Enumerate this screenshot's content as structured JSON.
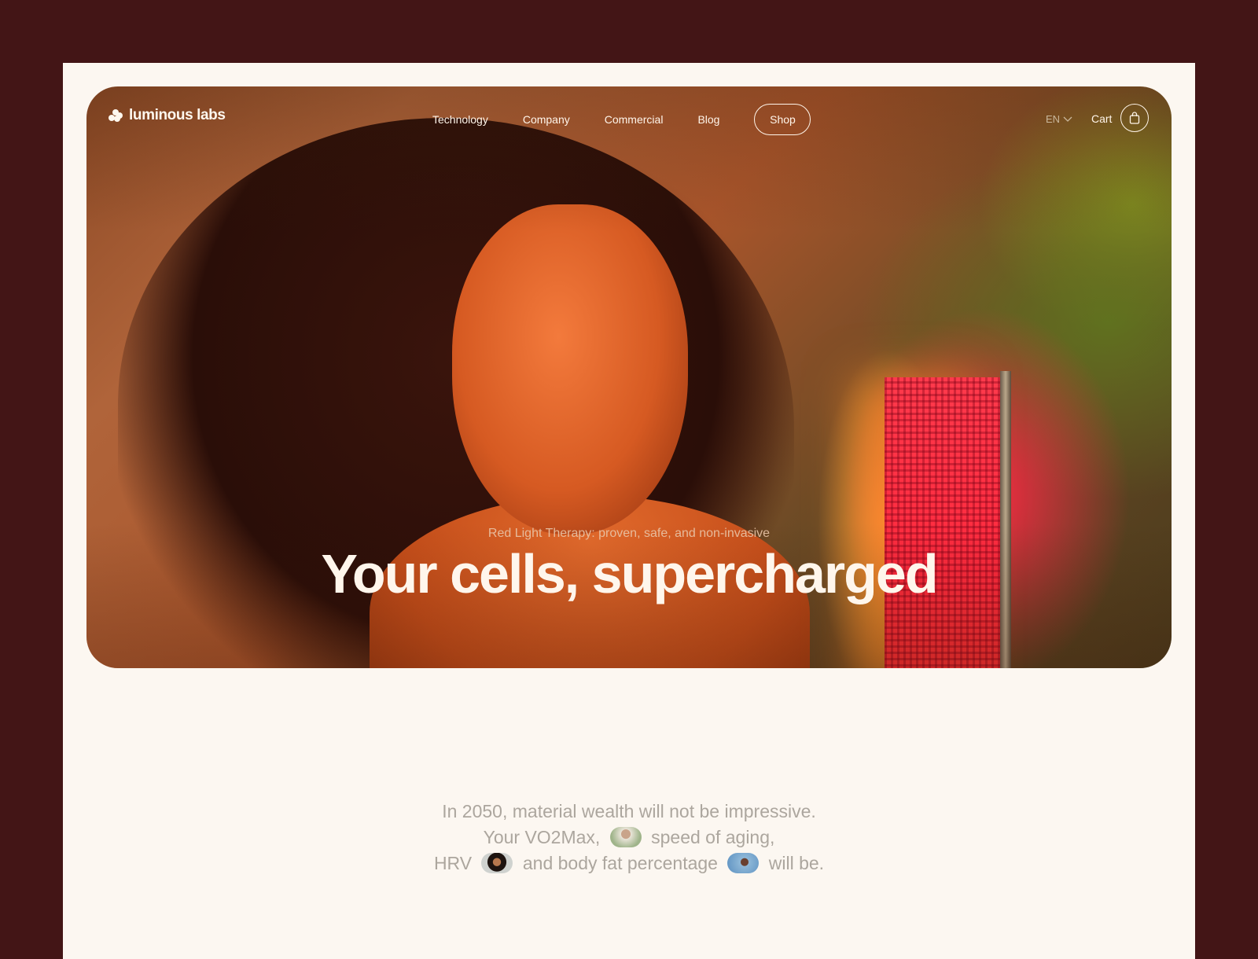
{
  "brand": {
    "name": "luminous labs",
    "logo_icon": "four-dots-cluster-icon",
    "colors": {
      "page_background": "#431516",
      "panel_background": "#fcf7f1",
      "nav_text": "#fff5ea",
      "statement_text": "#aca69e",
      "hero_light_red": "#ff2a3e"
    }
  },
  "nav": {
    "links": [
      {
        "label": "Technology"
      },
      {
        "label": "Company"
      },
      {
        "label": "Commercial"
      },
      {
        "label": "Blog"
      }
    ],
    "shop_label": "Shop",
    "language": "EN",
    "language_icon": "chevron-down-icon",
    "cart_label": "Cart",
    "cart_icon": "shopping-bag-icon"
  },
  "hero": {
    "eyebrow": "Red Light Therapy: proven, safe, and non-invasive",
    "headline": "Your cells, supercharged",
    "image_description": "Woman with curly hair, eyes closed, bathed in red light beside a red light therapy panel and a plant"
  },
  "statement": {
    "part1": "In 2050, material wealth will not be impressive. Your VO2Max,",
    "part2": "speed of aging,",
    "part3": "HRV",
    "part4": "and body fat percentage",
    "part5": "will be.",
    "avatars": [
      {
        "name": "woman-outdoors-avatar"
      },
      {
        "name": "curly-hair-woman-avatar"
      },
      {
        "name": "tennis-player-avatar"
      }
    ]
  }
}
